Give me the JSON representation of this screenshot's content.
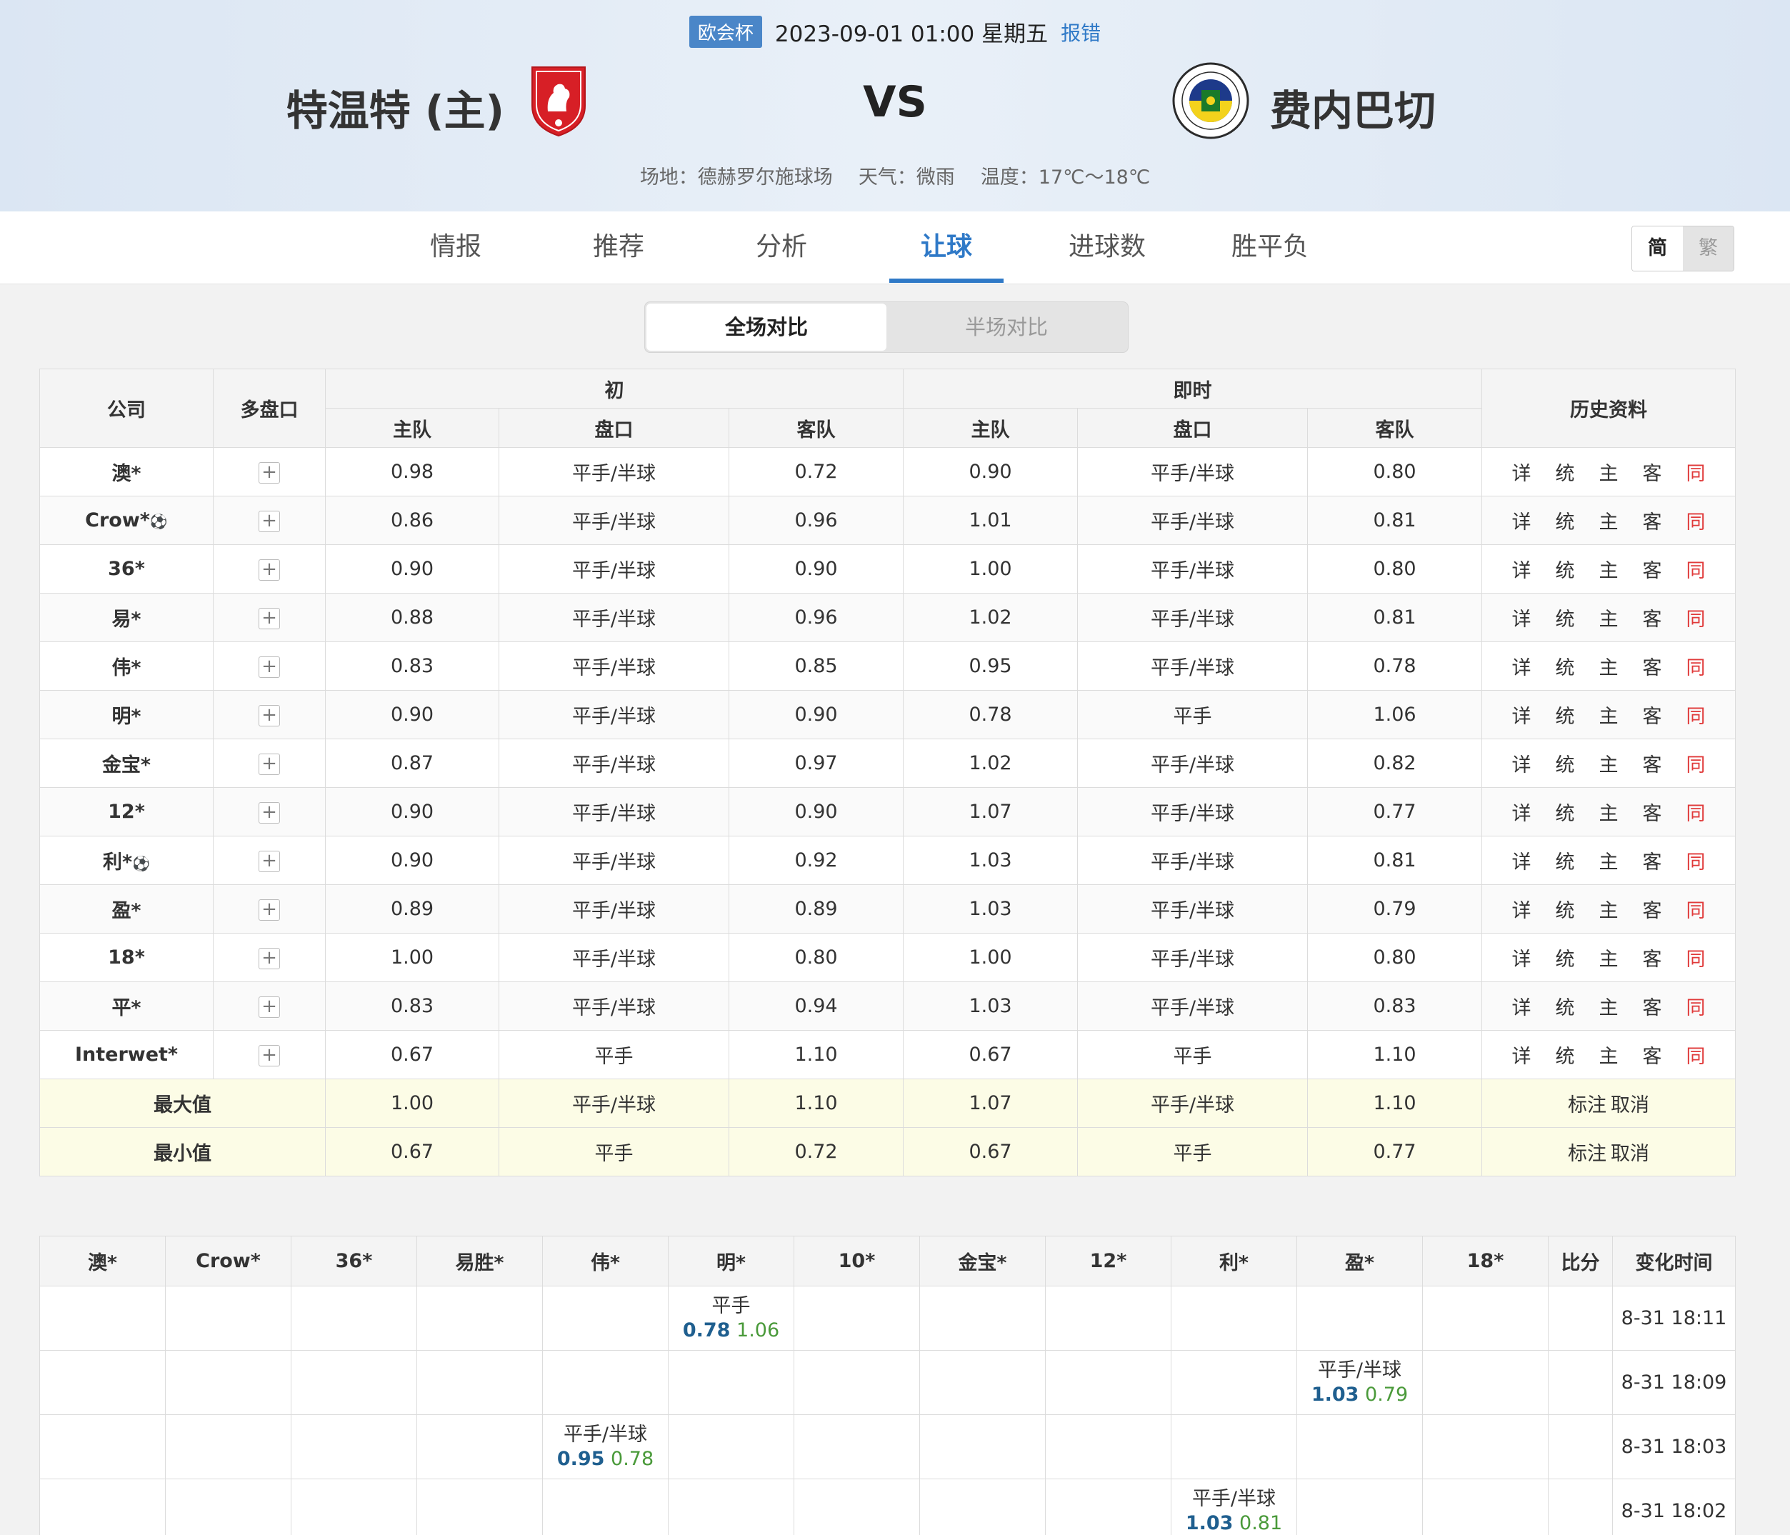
{
  "header": {
    "league": "欧会杯",
    "datetime": "2023-09-01 01:00 星期五",
    "report": "报错",
    "home_team": "特温特 (主)",
    "away_team": "费内巴切",
    "vs": "VS",
    "venue": "场地：德赫罗尔施球场",
    "weather": "天气：微雨",
    "temperature": "温度：17℃～18℃",
    "home_logo_icon": "fc-twente-crest",
    "away_logo_icon": "fenerbahce-crest"
  },
  "tabs": [
    "情报",
    "推荐",
    "分析",
    "让球",
    "进球数",
    "胜平负"
  ],
  "active_tab": "让球",
  "lang": {
    "simplified": "简",
    "traditional": "繁"
  },
  "segment": {
    "full": "全场对比",
    "half": "半场对比"
  },
  "odds_table": {
    "headers": {
      "company": "公司",
      "multi": "多盘口",
      "initial": "初",
      "live": "即时",
      "history": "历史资料",
      "home": "主队",
      "line": "盘口",
      "away": "客队"
    },
    "rows": [
      {
        "name": "澳*",
        "ball": "",
        "i_home": "0.98",
        "i_line": "平手/半球",
        "i_away": "0.72",
        "l_home": "0.90",
        "l_line": "平手/半球",
        "l_away": "0.80"
      },
      {
        "name": "Crow*",
        "ball": "⚽",
        "i_home": "0.86",
        "i_line": "平手/半球",
        "i_away": "0.96",
        "l_home": "1.01",
        "l_line": "平手/半球",
        "l_away": "0.81"
      },
      {
        "name": "36*",
        "ball": "",
        "i_home": "0.90",
        "i_line": "平手/半球",
        "i_away": "0.90",
        "l_home": "1.00",
        "l_line": "平手/半球",
        "l_away": "0.80"
      },
      {
        "name": "易*",
        "ball": "",
        "i_home": "0.88",
        "i_line": "平手/半球",
        "i_away": "0.96",
        "l_home": "1.02",
        "l_line": "平手/半球",
        "l_away": "0.81"
      },
      {
        "name": "伟*",
        "ball": "",
        "i_home": "0.83",
        "i_line": "平手/半球",
        "i_away": "0.85",
        "l_home": "0.95",
        "l_line": "平手/半球",
        "l_away": "0.78"
      },
      {
        "name": "明*",
        "ball": "",
        "i_home": "0.90",
        "i_line": "平手/半球",
        "i_away": "0.90",
        "l_home": "0.78",
        "l_line": "平手",
        "l_away": "1.06"
      },
      {
        "name": "金宝*",
        "ball": "",
        "i_home": "0.87",
        "i_line": "平手/半球",
        "i_away": "0.97",
        "l_home": "1.02",
        "l_line": "平手/半球",
        "l_away": "0.82"
      },
      {
        "name": "12*",
        "ball": "",
        "i_home": "0.90",
        "i_line": "平手/半球",
        "i_away": "0.90",
        "l_home": "1.07",
        "l_line": "平手/半球",
        "l_away": "0.77"
      },
      {
        "name": "利*",
        "ball": "⚽",
        "i_home": "0.90",
        "i_line": "平手/半球",
        "i_away": "0.92",
        "l_home": "1.03",
        "l_line": "平手/半球",
        "l_away": "0.81"
      },
      {
        "name": "盈*",
        "ball": "",
        "i_home": "0.89",
        "i_line": "平手/半球",
        "i_away": "0.89",
        "l_home": "1.03",
        "l_line": "平手/半球",
        "l_away": "0.79"
      },
      {
        "name": "18*",
        "ball": "",
        "i_home": "1.00",
        "i_line": "平手/半球",
        "i_away": "0.80",
        "l_home": "1.00",
        "l_line": "平手/半球",
        "l_away": "0.80"
      },
      {
        "name": "平*",
        "ball": "",
        "i_home": "0.83",
        "i_line": "平手/半球",
        "i_away": "0.94",
        "l_home": "1.03",
        "l_line": "平手/半球",
        "l_away": "0.83"
      },
      {
        "name": "Interwet*",
        "ball": "",
        "i_home": "0.67",
        "i_line": "平手",
        "i_away": "1.10",
        "l_home": "0.67",
        "l_line": "平手",
        "l_away": "1.10"
      }
    ],
    "history_links": [
      "详",
      "统",
      "主",
      "客",
      "同"
    ],
    "plus": "+",
    "summary": [
      {
        "label": "最大值",
        "i_home": "1.00",
        "i_line": "平手/半球",
        "i_away": "1.10",
        "l_home": "1.07",
        "l_line": "平手/半球",
        "l_away": "1.10"
      },
      {
        "label": "最小值",
        "i_home": "0.67",
        "i_line": "平手",
        "i_away": "0.72",
        "l_home": "0.67",
        "l_line": "平手",
        "l_away": "0.77"
      }
    ],
    "mark": "标注",
    "cancel": "取消"
  },
  "change_table": {
    "headers": [
      "澳*",
      "Crow*",
      "36*",
      "易胜*",
      "伟*",
      "明*",
      "10*",
      "金宝*",
      "12*",
      "利*",
      "盈*",
      "18*",
      "比分",
      "变化时间"
    ],
    "rows": [
      {
        "col": 5,
        "line": "平手",
        "home": "0.78",
        "away": "1.06",
        "time": "8-31 18:11"
      },
      {
        "col": 10,
        "line": "平手/半球",
        "home": "1.03",
        "away": "0.79",
        "time": "8-31 18:09"
      },
      {
        "col": 4,
        "line": "平手/半球",
        "home": "0.95",
        "away": "0.78",
        "time": "8-31 18:03"
      },
      {
        "col": 9,
        "line": "平手/半球",
        "home": "1.03",
        "away": "0.81",
        "time": "8-31 18:02"
      }
    ]
  },
  "colors": {
    "accent": "#2f79c7",
    "league_badge": "#4a86c8",
    "same_link": "#e03a3a",
    "summary_bg": "#fcfce6",
    "home_odds": "#1f5f8f",
    "away_odds": "#4a9a3a"
  }
}
